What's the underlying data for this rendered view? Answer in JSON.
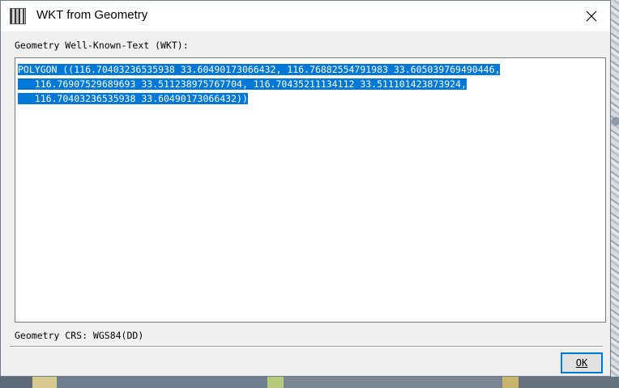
{
  "window": {
    "title": "WKT from Geometry",
    "app_icon": "app-icon",
    "close_icon": "close-icon"
  },
  "wkt": {
    "label": "Geometry Well-Known-Text (WKT):",
    "lines": [
      "POLYGON ((116.70403236535938 33.60490173066432, 116.76882554791983 33.605039769490446,",
      "   116.76907529689693 33.511238975767704, 116.70435211134112 33.511101423873924,",
      "   116.70403236535938 33.60490173066432))"
    ],
    "selected": true
  },
  "crs": {
    "label": "Geometry CRS: WGS84(DD)"
  },
  "buttons": {
    "ok_label": "OK"
  },
  "colors": {
    "selection": "#0078d7",
    "selection_text": "#ffffff",
    "dialog_bg": "#f0f0f0",
    "focus_border": "#0078d7"
  }
}
